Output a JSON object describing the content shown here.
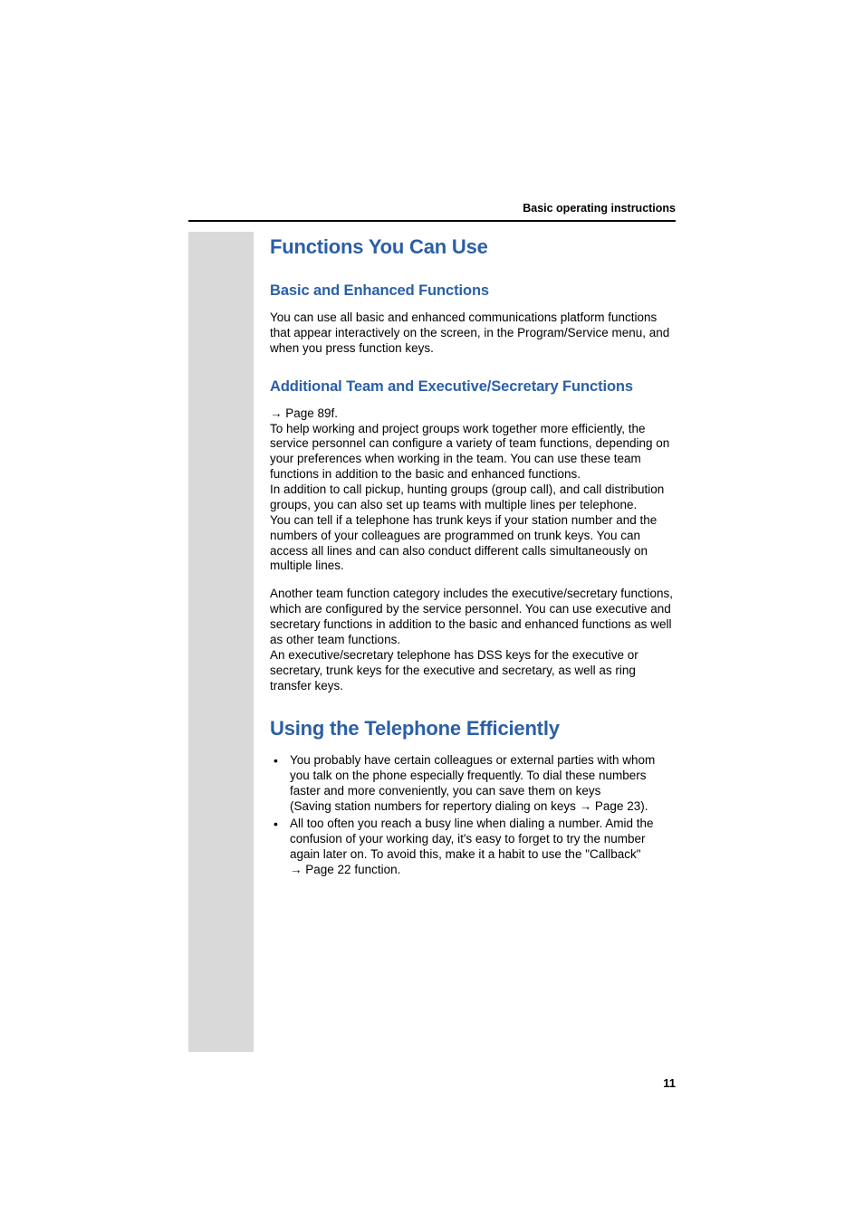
{
  "header": {
    "running": "Basic operating instructions"
  },
  "page": {
    "number": "11"
  },
  "sections": {
    "h1_a": "Functions You Can Use",
    "h2_basic": "Basic and Enhanced Functions",
    "p_basic": "You can use all basic and enhanced communications platform functions that appear interactively on the screen, in the Program/Service menu, and when you press function keys.",
    "h2_team": "Additional Team and Executive/Secretary Functions",
    "ref_team": "Page 89f.",
    "p_team_a": "To help working and project groups work together more efficiently, the service personnel can configure a variety of team functions, depending on your preferences when working in the team. You can use these team functions in addition to the basic and enhanced functions.",
    "p_team_b": "In addition to call pickup, hunting groups (group call), and call distribution groups, you can also set up teams with multiple lines per telephone.",
    "p_team_c": "You can tell if a telephone has trunk keys if your station number and the numbers of your colleagues are programmed on trunk keys. You can access all lines and can also conduct different calls simultaneously on multiple lines.",
    "p_team_d": "Another team function category includes the executive/secretary functions, which are configured by the service personnel. You can use executive and secretary functions in addition to the basic and enhanced functions as well as other team functions.",
    "p_team_e": "An executive/secretary telephone has DSS keys for the executive or secretary, trunk keys for the executive and secretary, as well as ring transfer keys.",
    "h1_b": "Using the Telephone Efficiently",
    "li1_a": "You probably have certain colleagues or external parties with whom you talk on the phone especially frequently. To dial these numbers faster and more conveniently, you can save them on keys",
    "li1_b_pre": "(Saving station numbers for repertory dialing on keys ",
    "li1_b_ref": "Page 23",
    "li1_b_post": ").",
    "li2_a": "All too often you reach a busy line when dialing a number. Amid the confusion of your working day, it's easy to forget to try the number again later on. To avoid this, make it a habit to use the \"Callback\" ",
    "li2_ref": "Page 22",
    "li2_post": " function."
  },
  "glyphs": {
    "arrow": "→"
  }
}
